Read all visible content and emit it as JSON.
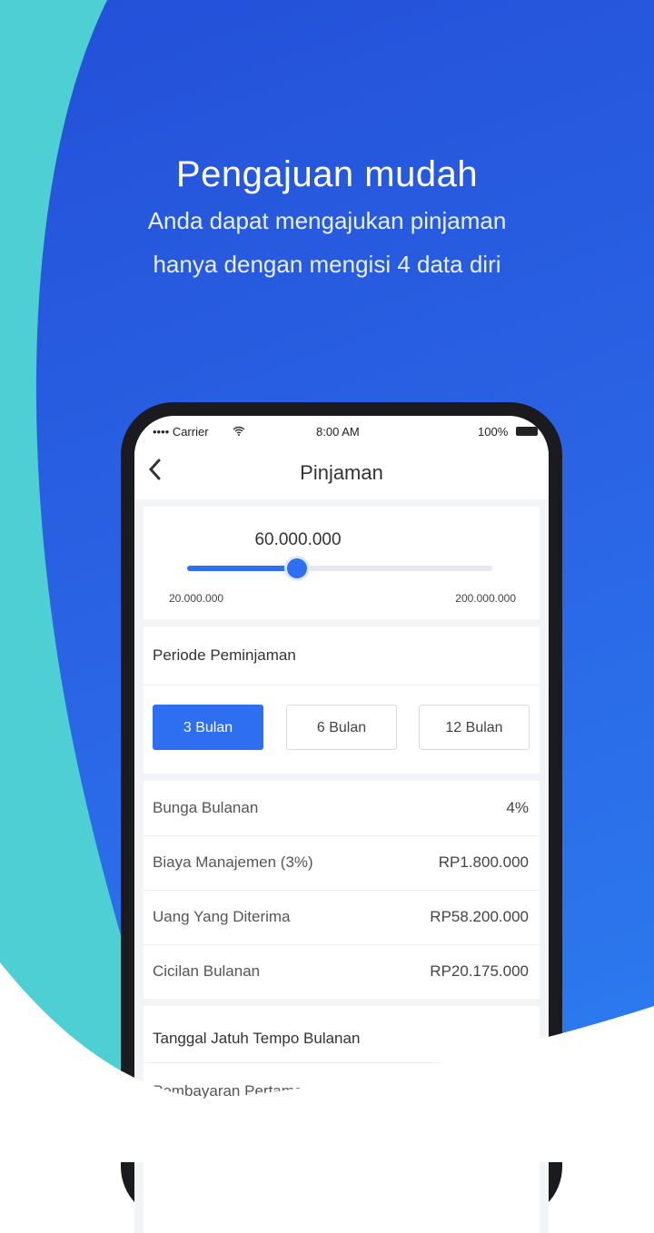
{
  "hero": {
    "title": "Pengajuan mudah",
    "subtitle_line1": "Anda dapat mengajukan pinjaman",
    "subtitle_line2": "hanya dengan mengisi 4 data diri"
  },
  "status_bar": {
    "carrier": "•••• Carrier",
    "wifi_icon": "wifi-icon",
    "time": "8:00 AM",
    "battery": "100%"
  },
  "nav": {
    "back_icon": "chevron-left-icon",
    "title": "Pinjaman"
  },
  "loan": {
    "amount": "60.000.000",
    "min_label": "20.000.000",
    "max_label": "200.000.000",
    "slider_fraction": 0.36
  },
  "period": {
    "label": "Periode Peminjaman",
    "options": [
      {
        "label": "3 Bulan",
        "selected": true
      },
      {
        "label": "6 Bulan",
        "selected": false
      },
      {
        "label": "12 Bulan",
        "selected": false
      }
    ]
  },
  "details": [
    {
      "label": "Bunga Bulanan",
      "value": "4%"
    },
    {
      "label": "Biaya Manajemen (3%)",
      "value": "RP1.800.000"
    },
    {
      "label": "Uang Yang Diterima",
      "value": "RP58.200.000"
    },
    {
      "label": "Cicilan Bulanan",
      "value": "RP20.175.000"
    }
  ],
  "due": {
    "title": "Tanggal Jatuh Tempo Bulanan",
    "first_payment": "Pembayaran Pertama"
  },
  "colors": {
    "brand_blue": "#2e6ef0",
    "teal_wave": "#4ecfd4",
    "background_blue": "#2a62e4"
  }
}
